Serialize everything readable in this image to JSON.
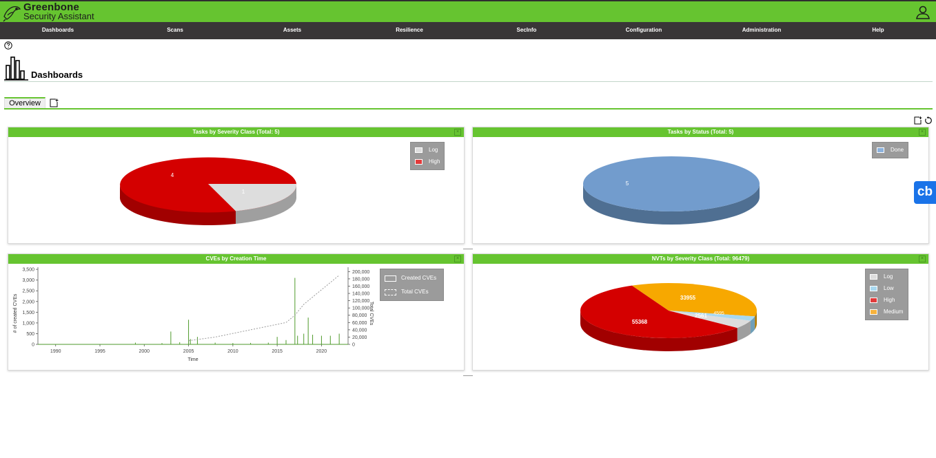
{
  "header": {
    "brand_line1": "Greenbone",
    "brand_line2": "Security Assistant"
  },
  "nav": [
    {
      "label": "Dashboards"
    },
    {
      "label": "Scans"
    },
    {
      "label": "Assets"
    },
    {
      "label": "Resilience"
    },
    {
      "label": "SecInfo"
    },
    {
      "label": "Configuration"
    },
    {
      "label": "Administration"
    },
    {
      "label": "Help"
    }
  ],
  "page": {
    "title": "Dashboards",
    "tabs": [
      {
        "label": "Overview"
      }
    ]
  },
  "panels": {
    "tasks_severity": {
      "title": "Tasks by Severity Class (Total: 5)",
      "close": "×",
      "legend": [
        {
          "label": "Log",
          "color": "#dddddd"
        },
        {
          "label": "High",
          "color": "#e23a3a"
        }
      ]
    },
    "tasks_status": {
      "title": "Tasks by Status (Total: 5)",
      "close": "×",
      "legend": [
        {
          "label": "Done",
          "color": "#8bb1dc"
        }
      ]
    },
    "cves_time": {
      "title": "CVEs by Creation Time",
      "close": "×",
      "legend": [
        {
          "label": "Created CVEs"
        },
        {
          "label": "Total CVEs"
        }
      ]
    },
    "nvts_severity": {
      "title": "NVTs by Severity Class (Total: 96479)",
      "close": "×",
      "legend": [
        {
          "label": "Log",
          "color": "#dddddd"
        },
        {
          "label": "Low",
          "color": "#a8d8f0"
        },
        {
          "label": "High",
          "color": "#e23a3a"
        },
        {
          "label": "Medium",
          "color": "#f7b23b"
        }
      ]
    }
  },
  "chart_data": [
    {
      "type": "pie",
      "title": "Tasks by Severity Class (Total: 5)",
      "series": [
        {
          "values": [
            1,
            4
          ]
        }
      ],
      "categories": [
        "Log",
        "High"
      ],
      "labels": [
        "1",
        "4"
      ],
      "colors": [
        "#dddddd",
        "#d40000"
      ]
    },
    {
      "type": "pie",
      "title": "Tasks by Status (Total: 5)",
      "series": [
        {
          "values": [
            5
          ]
        }
      ],
      "categories": [
        "Done"
      ],
      "labels": [
        "5"
      ],
      "colors": [
        "#729ccd"
      ]
    },
    {
      "type": "line",
      "title": "CVEs by Creation Time",
      "xlabel": "Time",
      "ylabel": "# of created CVEs",
      "y2label": "Total CVEs",
      "xlim": [
        1988,
        2023
      ],
      "ylim": [
        0,
        3600
      ],
      "y2lim": [
        0,
        212000
      ],
      "x_ticks": [
        "1990",
        "1995",
        "2000",
        "2005",
        "2010",
        "2015",
        "2020"
      ],
      "y_ticks": [
        "0",
        "500",
        "1,000",
        "1,500",
        "2,000",
        "2,500",
        "3,000",
        "3,500"
      ],
      "y2_ticks": [
        "0",
        "20,000",
        "40,000",
        "60,000",
        "80,000",
        "100,000",
        "120,000",
        "140,000",
        "160,000",
        "180,000",
        "200,000"
      ],
      "series": [
        {
          "name": "Created CVEs",
          "x": [
            1988,
            1999,
            2002,
            2003,
            2004,
            2005,
            2005.2,
            2006,
            2008,
            2010,
            2012,
            2014,
            2015,
            2016,
            2017,
            2017.3,
            2018,
            2018.5,
            2019,
            2020,
            2021,
            2022
          ],
          "y": [
            0,
            80,
            60,
            600,
            100,
            1150,
            250,
            350,
            80,
            60,
            70,
            80,
            350,
            200,
            3100,
            400,
            500,
            1250,
            450,
            400,
            400,
            500
          ]
        },
        {
          "name": "Total CVEs",
          "x": [
            2005,
            2008,
            2010,
            2012,
            2014,
            2016,
            2017,
            2018,
            2019,
            2020,
            2021,
            2022
          ],
          "y": [
            10000,
            20000,
            30000,
            40000,
            50000,
            60000,
            80000,
            110000,
            130000,
            150000,
            170000,
            190000
          ]
        }
      ]
    },
    {
      "type": "pie",
      "title": "NVTs by Severity Class (Total: 96479)",
      "series": [
        {
          "values": [
            33955,
            2561,
            4595,
            55368
          ]
        }
      ],
      "categories": [
        "Medium",
        "Low",
        "Log",
        "High"
      ],
      "labels": [
        "33955",
        "2561",
        "4595",
        "55368"
      ],
      "colors": [
        "#f7a800",
        "#a8d8f0",
        "#dddddd",
        "#d40000"
      ]
    }
  ],
  "badge": {
    "label": "cb"
  }
}
